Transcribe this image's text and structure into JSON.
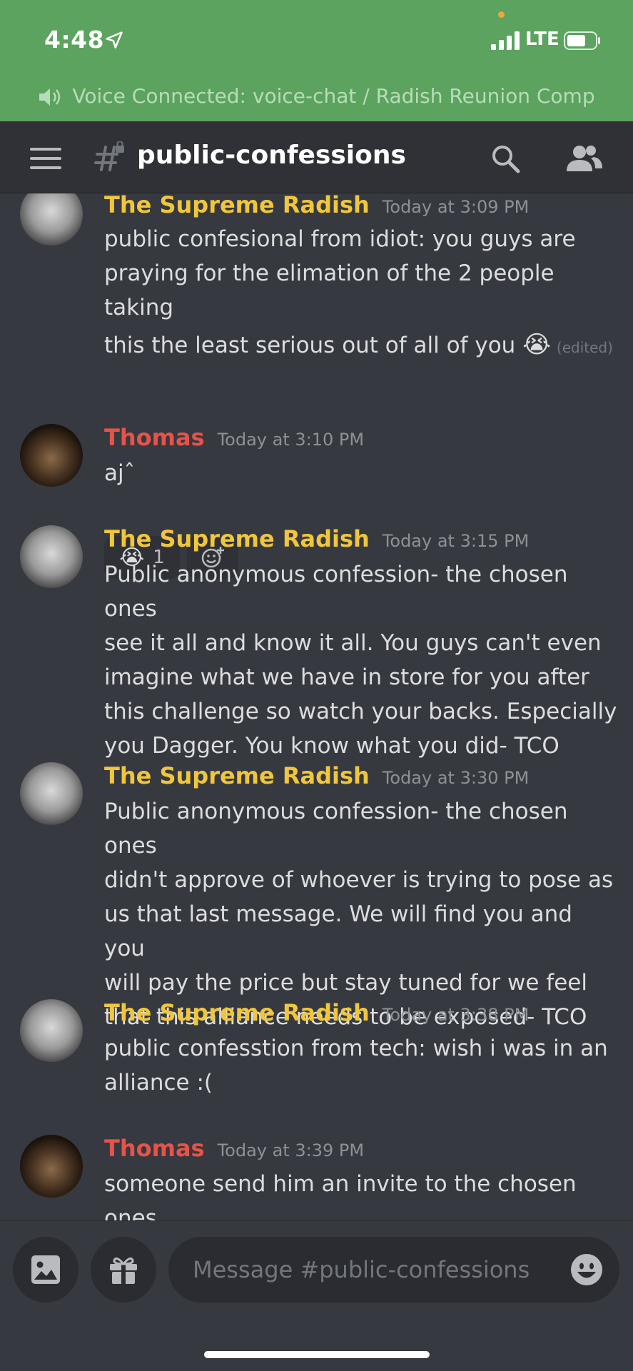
{
  "status_bar": {
    "time": "4:48",
    "network": "LTE"
  },
  "voice_banner": {
    "text": "Voice Connected: voice-chat / Radish Reunion Comp"
  },
  "header": {
    "channel": "public-confessions"
  },
  "colors": {
    "status_green": "#5ba35e",
    "bg": "#36393f",
    "radish_name": "#f0c63c",
    "thomas_name": "#e5534b"
  },
  "messages": [
    {
      "author": "The Supreme Radish",
      "timestamp": "Today at 3:09 PM",
      "lines": [
        "public confesional from idiot: you guys are",
        "praying for the elimation of the 2 people taking",
        "this the least serious out of all of you"
      ],
      "emoji": "😭",
      "edited": "(edited)",
      "reaction": {
        "emoji": "😭",
        "count": "1"
      }
    },
    {
      "author": "Thomas",
      "timestamp": "Today at 3:10 PM",
      "lines": [
        "ajˆ"
      ]
    },
    {
      "author": "The Supreme Radish",
      "timestamp": "Today at 3:15 PM",
      "lines": [
        "Public anonymous confession- the chosen ones",
        "see it all and know it all. You guys can't even",
        "imagine what we have in store for you after",
        "this challenge so watch your backs. Especially",
        "you Dagger. You know what you did- TCO"
      ]
    },
    {
      "author": "The Supreme Radish",
      "timestamp": "Today at 3:30 PM",
      "lines": [
        "Public anonymous confession- the chosen ones",
        "didn't approve of whoever is trying to pose as",
        "us that last message. We will find you and you",
        "will pay the price but stay tuned for we feel",
        "that this alliance needs to be exposed- TCO"
      ]
    },
    {
      "author": "The Supreme Radish",
      "timestamp": "Today at 3:38 PM",
      "lines": [
        "public confesstion from tech: wish i was in an",
        "alliance :("
      ]
    },
    {
      "author": "Thomas",
      "timestamp": "Today at 3:39 PM",
      "lines": [
        "someone send him an invite to the chosen ones"
      ]
    }
  ],
  "composer": {
    "placeholder": "Message #public-confessions"
  }
}
